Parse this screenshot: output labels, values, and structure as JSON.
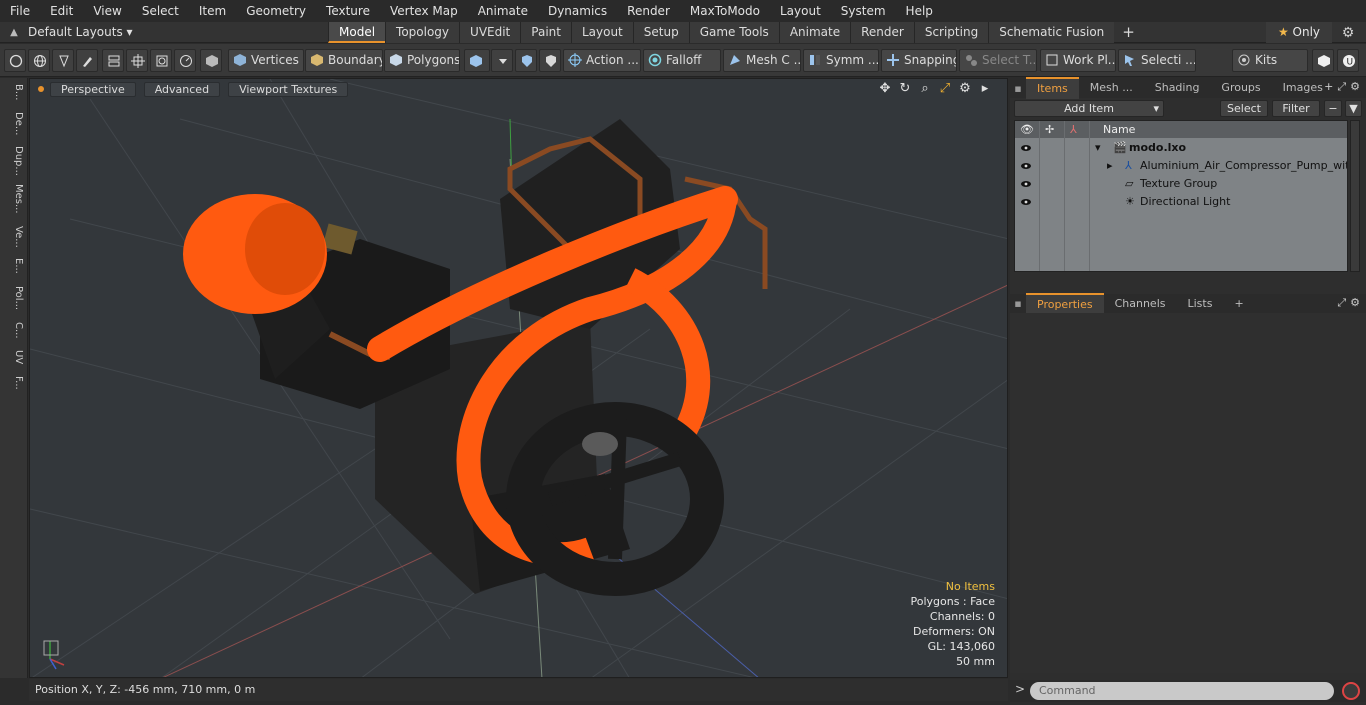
{
  "menu": [
    "File",
    "Edit",
    "View",
    "Select",
    "Item",
    "Geometry",
    "Texture",
    "Vertex Map",
    "Animate",
    "Dynamics",
    "Render",
    "MaxToModo",
    "Layout",
    "System",
    "Help"
  ],
  "layout": {
    "selector": "Default Layouts ▾",
    "tabs": [
      "Model",
      "Topology",
      "UVEdit",
      "Paint",
      "Layout",
      "Setup",
      "Game Tools",
      "Animate",
      "Render",
      "Scripting",
      "Schematic Fusion"
    ],
    "active_tab": "Model",
    "plus": "+",
    "only_label": "Only",
    "only_star": "★"
  },
  "toolbar": {
    "vertices": "Vertices",
    "boundary": "Boundary",
    "polygons": "Polygons",
    "action": "Action ...",
    "falloff": "Falloff",
    "mesh": "Mesh C ...",
    "symm": "Symm ...",
    "snapping": "Snapping",
    "select_t": "Select T...",
    "work_pl": "Work Pl...",
    "selecti": "Selecti ...",
    "kits": "Kits"
  },
  "left_tabs": [
    "B...",
    "De...",
    "Dup...",
    "Mes...",
    "Ve...",
    "E...",
    "Pol...",
    "C...",
    "UV",
    "F..."
  ],
  "viewport": {
    "perspective": "Perspective",
    "advanced": "Advanced",
    "textures": "Viewport Textures",
    "info": {
      "no_items": "No Items",
      "polygons": "Polygons : Face",
      "channels": "Channels: 0",
      "deformers": "Deformers: ON",
      "gl": "GL: 143,060",
      "scale": "50 mm"
    }
  },
  "status": {
    "position": "Position X, Y, Z:   -456 mm, 710 mm, 0 m"
  },
  "right_panel": {
    "tabs": [
      "Items",
      "Mesh ...",
      "Shading",
      "Groups",
      "Images"
    ],
    "active_tab": "Items",
    "add_item": "Add Item",
    "select": "Select",
    "filter": "Filter",
    "name_header": "Name",
    "tree": [
      {
        "label": "modo.lxo",
        "bold": true
      },
      {
        "label": "Aluminium_Air_Compressor_Pump_with_..."
      },
      {
        "label": "Texture Group"
      },
      {
        "label": "Directional Light"
      }
    ],
    "prop_tabs": [
      "Properties",
      "Channels",
      "Lists"
    ],
    "prop_active": "Properties",
    "command_placeholder": "Command"
  },
  "colors": {
    "accent": "#e8922c",
    "hose": "#ff5a10",
    "metal": "#1e1e1e",
    "copper": "#8a4a22"
  }
}
